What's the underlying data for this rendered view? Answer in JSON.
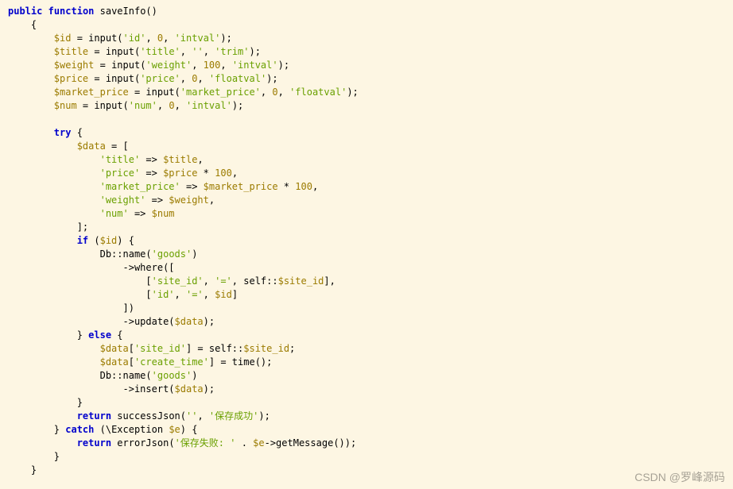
{
  "watermark": "CSDN @罗峰源码",
  "code": {
    "l1": {
      "kw1": "public",
      "kw2": "function",
      "fn": "saveInfo",
      "paren": "()"
    },
    "l2": {
      "brace": "{"
    },
    "l3": {
      "var": "$id",
      "eq": " = ",
      "fn": "input",
      "open": "(",
      "s1": "'id'",
      "c1": ", ",
      "n1": "0",
      "c2": ", ",
      "s2": "'intval'",
      "close": ");"
    },
    "l4": {
      "var": "$title",
      "eq": " = ",
      "fn": "input",
      "open": "(",
      "s1": "'title'",
      "c1": ", ",
      "s2": "''",
      "c2": ", ",
      "s3": "'trim'",
      "close": ");"
    },
    "l5": {
      "var": "$weight",
      "eq": " = ",
      "fn": "input",
      "open": "(",
      "s1": "'weight'",
      "c1": ", ",
      "n1": "100",
      "c2": ", ",
      "s2": "'intval'",
      "close": ");"
    },
    "l6": {
      "var": "$price",
      "eq": " = ",
      "fn": "input",
      "open": "(",
      "s1": "'price'",
      "c1": ", ",
      "n1": "0",
      "c2": ", ",
      "s2": "'floatval'",
      "close": ");"
    },
    "l7": {
      "var": "$market_price",
      "eq": " = ",
      "fn": "input",
      "open": "(",
      "s1": "'market_price'",
      "c1": ", ",
      "n1": "0",
      "c2": ", ",
      "s2": "'floatval'",
      "close": ");"
    },
    "l8": {
      "var": "$num",
      "eq": " = ",
      "fn": "input",
      "open": "(",
      "s1": "'num'",
      "c1": ", ",
      "n1": "0",
      "c2": ", ",
      "s2": "'intval'",
      "close": ");"
    },
    "l10": {
      "kw": "try",
      "brace": " {"
    },
    "l11": {
      "var": "$data",
      "eq": " = ",
      "brace": "["
    },
    "l12": {
      "s": "'title'",
      "arrow": " => ",
      "var": "$title",
      "c": ","
    },
    "l13": {
      "s": "'price'",
      "arrow": " => ",
      "var": "$price",
      "op": " * ",
      "n": "100",
      "c": ","
    },
    "l14": {
      "s": "'market_price'",
      "arrow": " => ",
      "var": "$market_price",
      "op": " * ",
      "n": "100",
      "c": ","
    },
    "l15": {
      "s": "'weight'",
      "arrow": " => ",
      "var": "$weight",
      "c": ","
    },
    "l16": {
      "s": "'num'",
      "arrow": " => ",
      "var": "$num"
    },
    "l17": {
      "brace": "];"
    },
    "l18": {
      "kw": "if",
      "open": " (",
      "var": "$id",
      "close": ") {"
    },
    "l19": {
      "cls": "Db",
      "fn": "::name",
      "open": "(",
      "s": "'goods'",
      "close": ")"
    },
    "l20": {
      "fn": "->where",
      "open": "(["
    },
    "l21": {
      "open": "[",
      "s1": "'site_id'",
      "c1": ", ",
      "s2": "'='",
      "c2": ", ",
      "self": "self::",
      "var": "$site_id",
      "close": "],"
    },
    "l22": {
      "open": "[",
      "s1": "'id'",
      "c1": ", ",
      "s2": "'='",
      "c2": ", ",
      "var": "$id",
      "close": "]"
    },
    "l23": {
      "close": "])"
    },
    "l24": {
      "fn": "->update",
      "open": "(",
      "var": "$data",
      "close": ");"
    },
    "l25": {
      "brace": "}",
      "kw": " else ",
      "brace2": "{"
    },
    "l26": {
      "var": "$data",
      "open": "[",
      "s": "'site_id'",
      "close": "] = ",
      "self": "self::",
      "var2": "$site_id",
      "semi": ";"
    },
    "l27": {
      "var": "$data",
      "open": "[",
      "s": "'create_time'",
      "close": "] = ",
      "fn": "time",
      "paren": "();"
    },
    "l28": {
      "cls": "Db",
      "fn": "::name",
      "open": "(",
      "s": "'goods'",
      "close": ")"
    },
    "l29": {
      "fn": "->insert",
      "open": "(",
      "var": "$data",
      "close": ");"
    },
    "l30": {
      "brace": "}"
    },
    "l31": {
      "kw": "return",
      "sp": " ",
      "fn": "successJson",
      "open": "(",
      "s1": "''",
      "c": ", ",
      "s2": "'保存成功'",
      "close": ");"
    },
    "l32": {
      "brace": "}",
      "kw": " catch ",
      "open": "(\\",
      "cls": "Exception",
      "sp": " ",
      "var": "$e",
      "close": ") {"
    },
    "l33": {
      "kw": "return",
      "sp": " ",
      "fn": "errorJson",
      "open": "(",
      "s1": "'保存失败: '",
      "op": " . ",
      "var": "$e",
      "fn2": "->getMessage",
      "paren": "()",
      "close": ");"
    },
    "l34": {
      "brace": "}"
    },
    "l35": {
      "brace": "}"
    }
  }
}
